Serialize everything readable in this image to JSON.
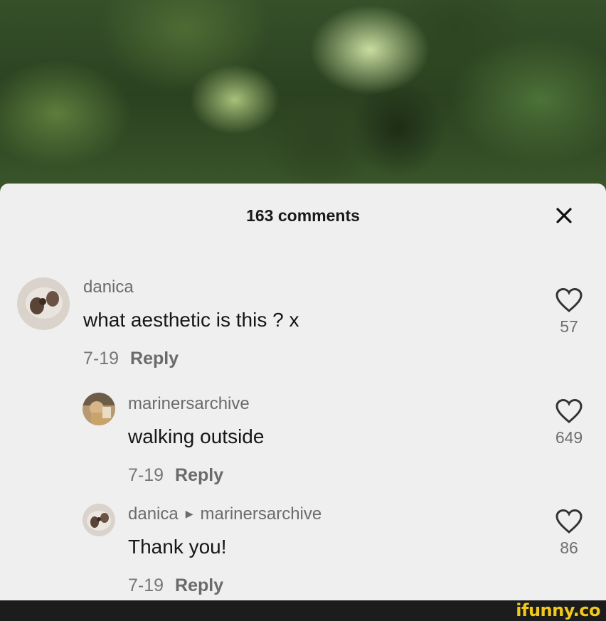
{
  "comments_header": {
    "title": "163 comments"
  },
  "comments": [
    {
      "username": "danica",
      "text": "what aesthetic is this ? x",
      "date": "7-19",
      "reply_label": "Reply",
      "likes": "57"
    },
    {
      "username": "marinersarchive",
      "text": "walking outside",
      "date": "7-19",
      "reply_label": "Reply",
      "likes": "649"
    },
    {
      "username": "danica",
      "reply_to": "marinersarchive",
      "text": "Thank you!",
      "date": "7-19",
      "reply_label": "Reply",
      "likes": "86"
    }
  ],
  "icons": {
    "close": "close-icon",
    "like": "heart-outline-icon",
    "reply_arrow": "triangle-right-icon"
  },
  "colors": {
    "sheet_background": "#efefef",
    "watermark": "#f2c81a"
  },
  "watermark": {
    "text": "ifunny.co"
  }
}
